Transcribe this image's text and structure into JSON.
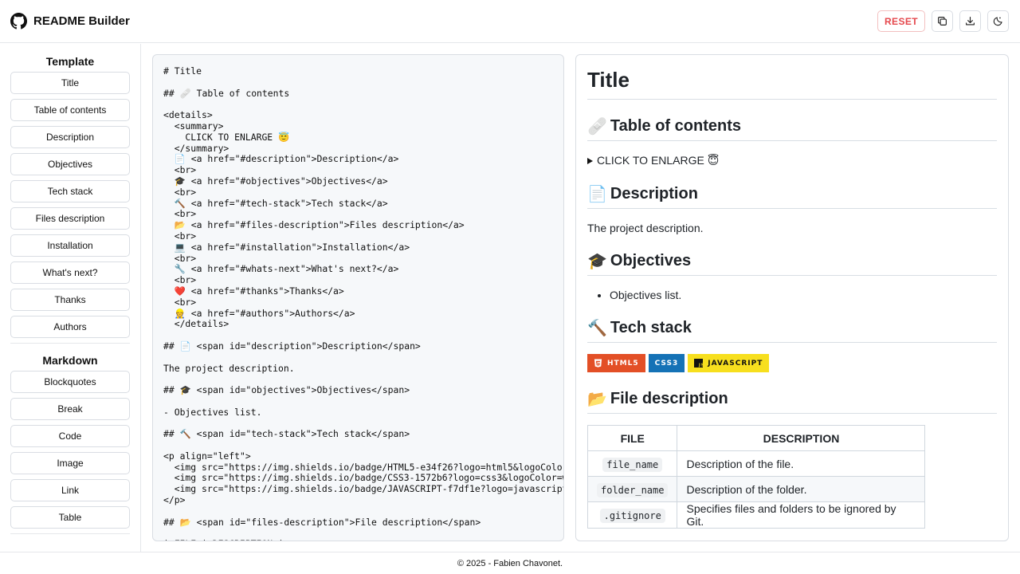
{
  "app": {
    "title": "README Builder"
  },
  "header": {
    "reset_label": "RESET"
  },
  "sidebar": {
    "template_title": "Template",
    "template_items": [
      "Title",
      "Table of contents",
      "Description",
      "Objectives",
      "Tech stack",
      "Files description",
      "Installation",
      "What's next?",
      "Thanks",
      "Authors"
    ],
    "markdown_title": "Markdown",
    "markdown_items": [
      "Blockquotes",
      "Break",
      "Code",
      "Image",
      "Link",
      "Table"
    ]
  },
  "editor": {
    "content": "# Title\n\n## 🩹 Table of contents\n\n<details>\n  <summary>\n    CLICK TO ENLARGE 😇\n  </summary>\n  📄 <a href=\"#description\">Description</a>\n  <br>\n  🎓 <a href=\"#objectives\">Objectives</a>\n  <br>\n  🔨 <a href=\"#tech-stack\">Tech stack</a>\n  <br>\n  📂 <a href=\"#files-description\">Files description</a>\n  <br>\n  💻 <a href=\"#installation\">Installation</a>\n  <br>\n  🔧 <a href=\"#whats-next\">What's next?</a>\n  <br>\n  ❤️ <a href=\"#thanks\">Thanks</a>\n  <br>\n  👷 <a href=\"#authors\">Authors</a>\n  </details>\n\n## 📄 <span id=\"description\">Description</span>\n\nThe project description.\n\n## 🎓 <span id=\"objectives\">Objectives</span>\n\n- Objectives list.\n\n## 🔨 <span id=\"tech-stack\">Tech stack</span>\n\n<p align=\"left\">\n  <img src=\"https://img.shields.io/badge/HTML5-e34f26?logo=html5&logoColor=white\">\n  <img src=\"https://img.shields.io/badge/CSS3-1572b6?logo=css3&logoColor=white\">\n  <img src=\"https://img.shields.io/badge/JAVASCRIPT-f7df1e?logo=javascript\">\n</p>\n\n## 📂 <span id=\"files-description\">File description</span>\n\n| FILE | DESCRIPTION |"
  },
  "preview": {
    "h1": "Title",
    "toc": {
      "emoji": "🩹",
      "heading": "Table of contents"
    },
    "summary": "CLICK TO ENLARGE 😇",
    "description": {
      "emoji": "📄",
      "heading": "Description",
      "text": "The project description."
    },
    "objectives": {
      "emoji": "🎓",
      "heading": "Objectives",
      "item": "Objectives list."
    },
    "tech": {
      "emoji": "🔨",
      "heading": "Tech stack"
    },
    "badges": [
      {
        "label": "HTML5",
        "color": "#e34f26",
        "icon": "html5-icon"
      },
      {
        "label": "CSS3",
        "color": "#1572b6",
        "icon": ""
      },
      {
        "label": "JAVASCRIPT",
        "color": "#f7df1e",
        "icon": "javascript-icon"
      }
    ],
    "files": {
      "emoji": "📂",
      "heading": "File description",
      "headers": [
        "FILE",
        "DESCRIPTION"
      ],
      "rows": [
        {
          "file": "file_name",
          "description": "Description of the file."
        },
        {
          "file": "folder_name",
          "description": "Description of the folder."
        },
        {
          "file": ".gitignore",
          "description": "Specifies files and folders to be ignored by Git."
        }
      ]
    }
  },
  "footer": {
    "text": "© 2025 - Fabien Chavonet."
  }
}
